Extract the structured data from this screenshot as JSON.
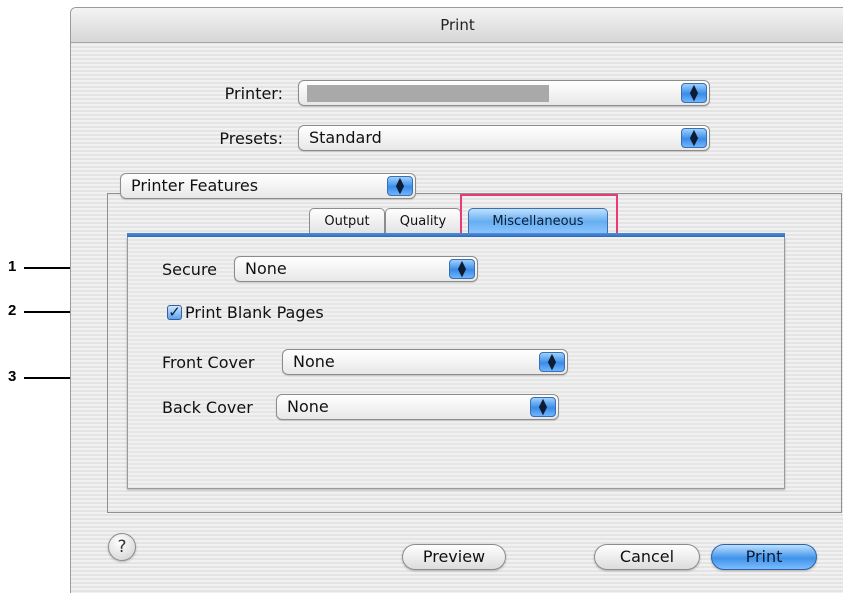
{
  "window": {
    "title": "Print"
  },
  "printer": {
    "label": "Printer:",
    "value": ""
  },
  "presets": {
    "label": "Presets:",
    "value": "Standard"
  },
  "features_popup": {
    "value": "Printer Features"
  },
  "tabs": [
    {
      "label": "Output",
      "selected": false
    },
    {
      "label": "Quality",
      "selected": false
    },
    {
      "label": "Miscellaneous",
      "selected": true
    }
  ],
  "misc": {
    "secure": {
      "label": "Secure",
      "value": "None"
    },
    "blank_pages": {
      "label": "Print Blank Pages",
      "checked": true
    },
    "front_cover": {
      "label": "Front Cover",
      "value": "None"
    },
    "back_cover": {
      "label": "Back Cover",
      "value": "None"
    }
  },
  "buttons": {
    "help": "?",
    "preview": "Preview",
    "cancel": "Cancel",
    "print": "Print"
  },
  "callouts": [
    "1",
    "2",
    "3"
  ],
  "colors": {
    "accent_blue": "#3f93ea",
    "highlight_pink": "#e83a7a"
  }
}
